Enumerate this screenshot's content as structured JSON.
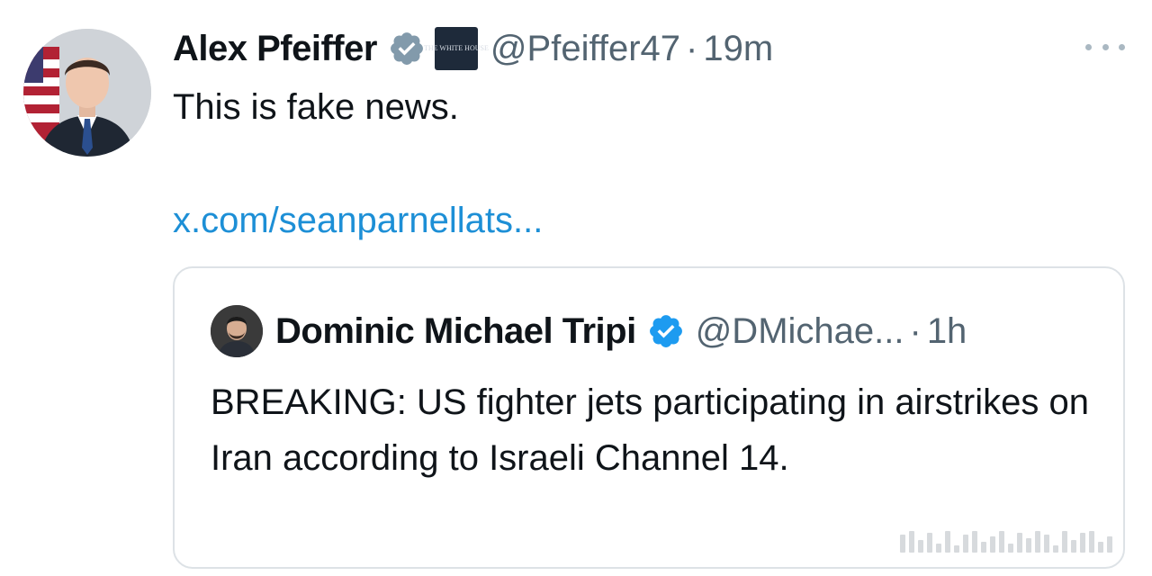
{
  "tweet": {
    "author_name": "Alex Pfeiffer",
    "handle": "@Pfeiffer47",
    "separator": "·",
    "time": "19m",
    "org_badge_text": "THE WHITE HOUSE",
    "text": "This is fake news.",
    "link": "x.com/seanparnellats..."
  },
  "quoted_tweet": {
    "author_name": "Dominic Michael Tripi",
    "handle": "@DMichae...",
    "separator": "·",
    "time": "1h",
    "text": "BREAKING: US fighter jets participating in airstrikes on Iran according to Israeli Channel 14."
  },
  "icons": {
    "verified": "verified-badge-icon",
    "more": "more-options-icon"
  },
  "colors": {
    "link": "#1d8fd6",
    "muted": "#536471",
    "verified_blue": "#1d9bf0",
    "verified_gray": "#829aab"
  }
}
